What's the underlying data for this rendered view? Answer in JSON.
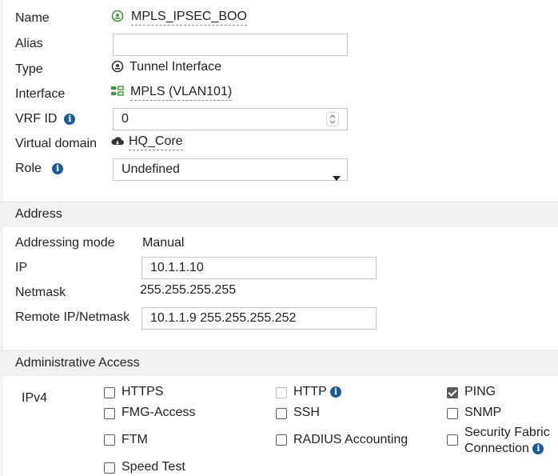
{
  "form": {
    "name_label": "Name",
    "name_value": "MPLS_IPSEC_BOO",
    "alias_label": "Alias",
    "alias_value": "",
    "type_label": "Type",
    "type_value": "Tunnel Interface",
    "interface_label": "Interface",
    "interface_value": "MPLS (VLAN101)",
    "vrf_label": "VRF ID",
    "vrf_value": "0",
    "vdom_label": "Virtual domain",
    "vdom_value": "HQ_Core",
    "role_label": "Role",
    "role_value": "Undefined"
  },
  "address": {
    "section_title": "Address",
    "mode_label": "Addressing mode",
    "mode_value": "Manual",
    "ip_label": "IP",
    "ip_value": "10.1.1.10",
    "netmask_label": "Netmask",
    "netmask_value": "255.255.255.255",
    "remote_label": "Remote IP/Netmask",
    "remote_value": "10.1.1.9 255.255.255.252"
  },
  "admin_access": {
    "section_title": "Administrative Access",
    "ipv4_label": "IPv4",
    "https": "HTTPS",
    "http": "HTTP",
    "ping": "PING",
    "fmg": "FMG-Access",
    "ssh": "SSH",
    "snmp": "SNMP",
    "ftm": "FTM",
    "radius": "RADIUS Accounting",
    "fabric_line1": "Security Fabric",
    "fabric_line2": "Connection",
    "speed": "Speed Test"
  },
  "colors": {
    "accent_green": "#3a9a3a",
    "info_blue": "#1a5b9c",
    "section_bg": "#f1f1f1"
  }
}
